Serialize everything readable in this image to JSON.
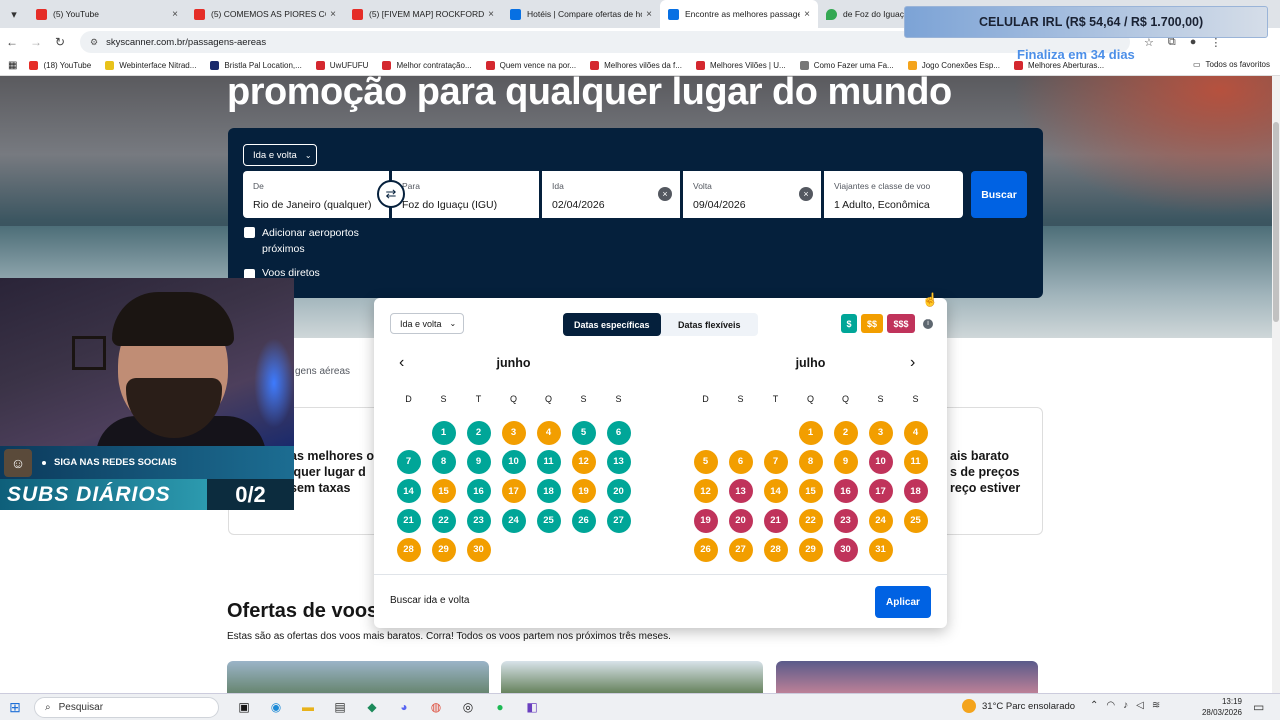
{
  "browser": {
    "tabs": [
      {
        "title": "(5) YouTube",
        "icon": "youtube-icon"
      },
      {
        "title": "(5) COMEMOS AS PIORES COM",
        "icon": "youtube-icon"
      },
      {
        "title": "(5) [FIVEM MAP] ROCKFORD CI",
        "icon": "youtube-icon"
      },
      {
        "title": "Hotéis | Compare ofertas de ho",
        "icon": "skyscanner-icon"
      },
      {
        "title": "Encontre as melhores passage",
        "icon": "skyscanner-icon"
      },
      {
        "title": "de Foz do Iguaçu",
        "icon": "maps-pin-icon"
      }
    ],
    "url": "skyscanner.com.br/passagens-aereas",
    "bookmarks": [
      {
        "label": "(18) YouTube",
        "color": "#e52d27"
      },
      {
        "label": "Webinterface Nitrad...",
        "color": "#e8c21a"
      },
      {
        "label": "Bristla Pal Location,...",
        "color": "#1a2a6c"
      },
      {
        "label": "UwUFUFU",
        "color": "#d4282f"
      },
      {
        "label": "Melhor contratação...",
        "color": "#d4282f"
      },
      {
        "label": "Quem vence na por...",
        "color": "#d4282f"
      },
      {
        "label": "Melhores vilões da f...",
        "color": "#d4282f"
      },
      {
        "label": "Melhores Vilões | U...",
        "color": "#d4282f"
      },
      {
        "label": "Como Fazer uma Fa...",
        "color": "#777777"
      },
      {
        "label": "Jogo Conexões Esp...",
        "color": "#f4a41c"
      },
      {
        "label": "Melhores Aberturas...",
        "color": "#d4282f"
      }
    ],
    "bookmarks_all": "Todos os favoritos"
  },
  "hero": {
    "title": "promoção para qualquer lugar do mundo"
  },
  "search": {
    "trip_type": "Ida e volta",
    "from_label": "De",
    "from_value": "Rio de Janeiro (qualquer)",
    "to_label": "Para",
    "to_value": "Foz do Iguaçu (IGU)",
    "depart_label": "Ida",
    "depart_value": "02/04/2026",
    "return_label": "Volta",
    "return_value": "09/04/2026",
    "travelers_label": "Viajantes e classe de voo",
    "travelers_value": "1 Adulto, Econômica",
    "search_button": "Buscar",
    "nearby_airports": "Adicionar aeroportos próximos",
    "direct_flights": "Voos diretos"
  },
  "calendar": {
    "trip_type": "Ida e volta",
    "tab_specific": "Datas específicas",
    "tab_flexible": "Datas flexíveis",
    "price_keys": [
      "$",
      "$$",
      "$$$"
    ],
    "weekdays": [
      "D",
      "S",
      "T",
      "Q",
      "Q",
      "S",
      "S"
    ],
    "months": [
      {
        "name": "junho",
        "offset": 1,
        "days": [
          "g",
          "g",
          "o",
          "o",
          "g",
          "g",
          "g",
          "g",
          "g",
          "g",
          "g",
          "o",
          "g",
          "g",
          "o",
          "g",
          "o",
          "g",
          "o",
          "g",
          "g",
          "g",
          "g",
          "g",
          "g",
          "g",
          "g",
          "o",
          "o",
          "o"
        ]
      },
      {
        "name": "julho",
        "offset": 3,
        "days": [
          "o",
          "o",
          "o",
          "o",
          "o",
          "o",
          "o",
          "o",
          "o",
          "r",
          "o",
          "o",
          "r",
          "o",
          "o",
          "r",
          "r",
          "r",
          "r",
          "r",
          "r",
          "o",
          "r",
          "o",
          "o",
          "o",
          "o",
          "o",
          "o",
          "r",
          "o"
        ]
      }
    ],
    "footer_text": "Buscar ida e volta",
    "apply_button": "Aplicar"
  },
  "page": {
    "breadcrumb_fragment": "gens aéreas",
    "promo_left": [
      "as melhores o",
      "lquer lugar d",
      "sem taxas"
    ],
    "promo_right": [
      "ais barato",
      "s de preços",
      "reço estiver"
    ],
    "offers_title": "Ofertas de voos partindo de Brasil",
    "offers_subtitle": "Estas são as ofertas dos voos mais baratos. Corra! Todos os voos partem nos próximos três meses."
  },
  "overlay": {
    "social_text": "SIGA NAS REDES SOCIAIS",
    "subs_label": "SUBS DIÁRIOS",
    "subs_count": "0/2",
    "banner_text": "CELULAR IRL (R$ 54,64 / R$ 1.700,00)",
    "banner_sub": "Finaliza em 34 dias"
  },
  "taskbar": {
    "search_placeholder": "Pesquisar",
    "weather": "31°C  Parc ensolarado",
    "time": "13:19",
    "date": "28/03/2026"
  },
  "colors": {
    "cheap": "#00a698",
    "medium": "#f29e00",
    "expensive": "#c0335b",
    "brand_blue": "#0062e3",
    "navy": "#05203c"
  }
}
